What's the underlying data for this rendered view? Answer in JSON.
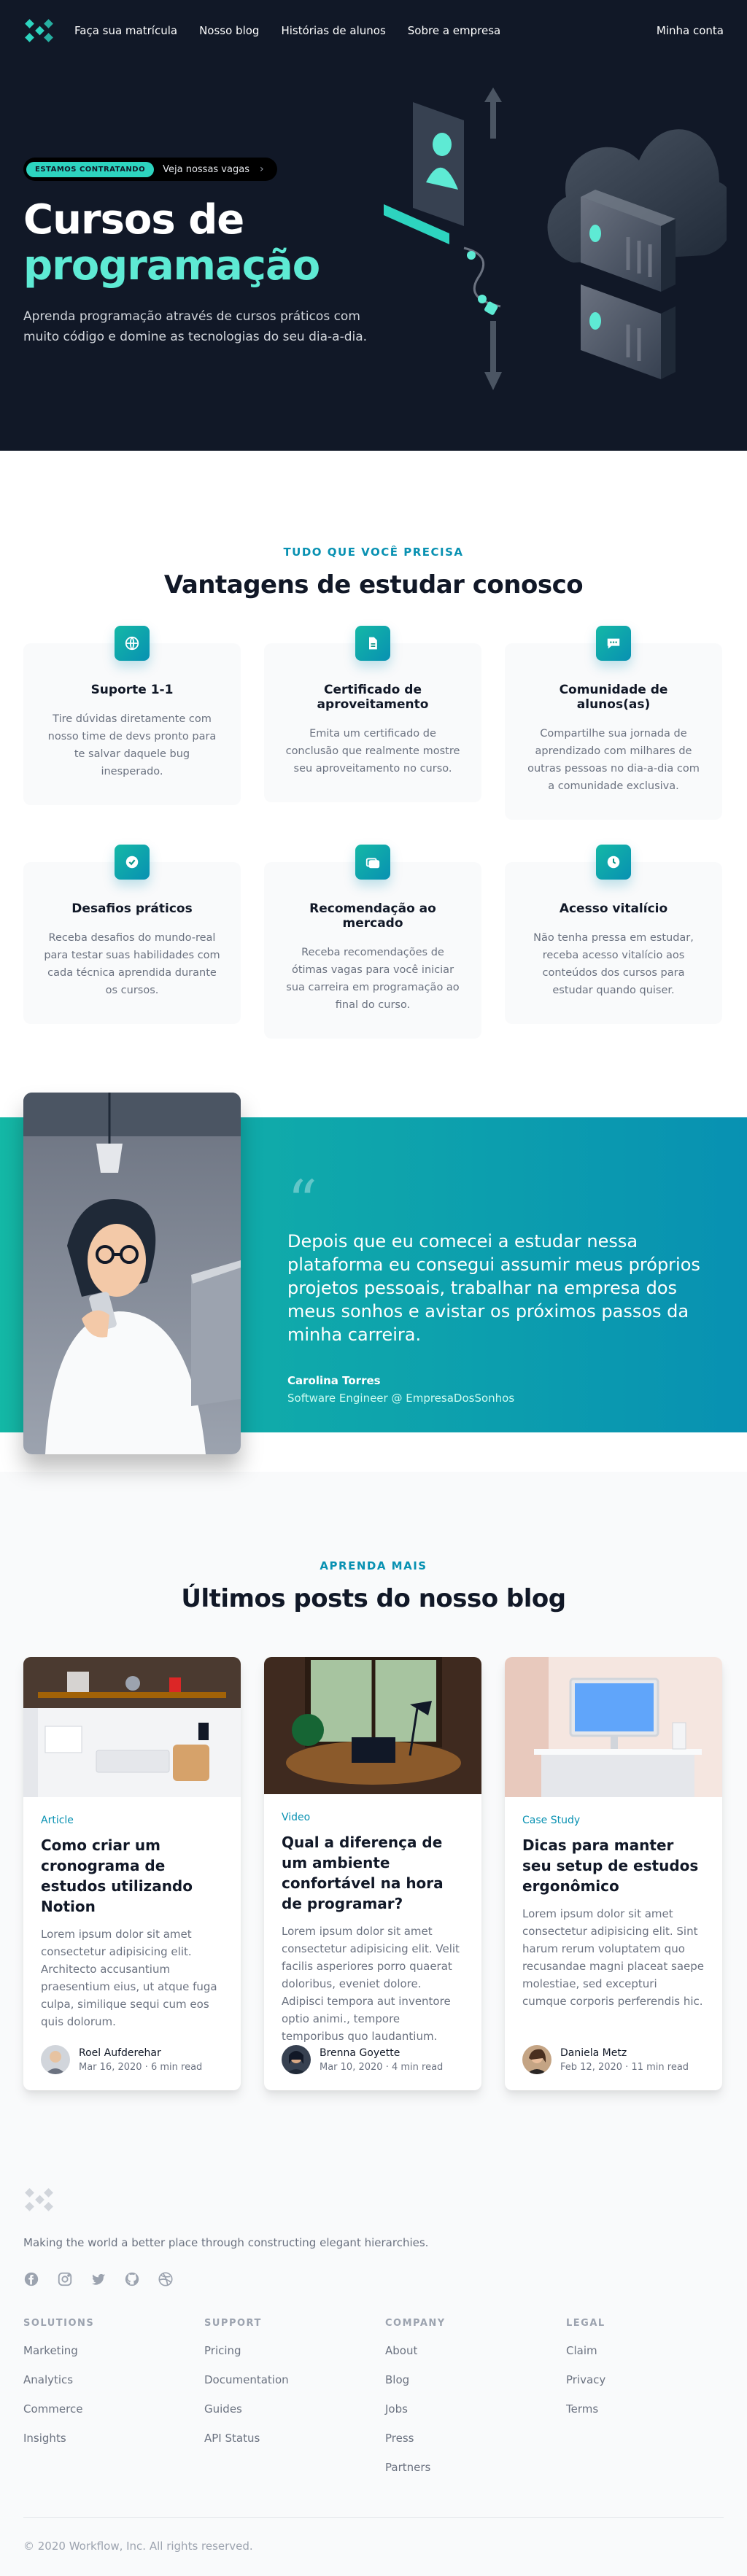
{
  "nav": {
    "links": [
      "Faça sua matrícula",
      "Nosso blog",
      "Histórias de alunos",
      "Sobre a empresa"
    ],
    "account": "Minha conta"
  },
  "hero": {
    "badge": "Estamos contratando",
    "badge_link": "Veja nossas vagas",
    "title_line1": "Cursos de",
    "title_line2": "programação",
    "subtitle": "Aprenda programação através de cursos práticos com muito código e domine as tecnologias do seu dia-a-dia."
  },
  "features": {
    "eyebrow": "Tudo que você precisa",
    "title": "Vantagens de estudar conosco",
    "items": [
      {
        "icon": "globe-icon",
        "title": "Suporte 1-1",
        "text": "Tire dúvidas diretamente com nosso time de devs pronto para te salvar daquele bug inesperado."
      },
      {
        "icon": "document-icon",
        "title": "Certificado de aproveitamento",
        "text": "Emita um certificado de conclusão que realmente mostre seu aproveitamento no curso."
      },
      {
        "icon": "chat-icon",
        "title": "Comunidade de alunos(as)",
        "text": "Compartilhe sua jornada de aprendizado com milhares de outras pessoas no dia-a-dia com a comunidade exclusiva."
      },
      {
        "icon": "check-badge-icon",
        "title": "Desafios práticos",
        "text": "Receba desafios do mundo-real para testar suas habilidades com cada técnica aprendida durante os cursos."
      },
      {
        "icon": "collection-icon",
        "title": "Recomendação ao mercado",
        "text": "Receba recomendações de ótimas vagas para você iniciar sua carreira em programação ao final do curso."
      },
      {
        "icon": "clock-icon",
        "title": "Acesso vitalício",
        "text": "Não tenha pressa em estudar, receba acesso vitalício aos conteúdos dos cursos para estudar quando quiser."
      }
    ]
  },
  "testimonial": {
    "quote": "Depois que eu comecei a estudar nessa plataforma eu consegui assumir meus próprios projetos pessoais, trabalhar na empresa dos meus sonhos e avistar os próximos passos da minha carreira.",
    "name": "Carolina Torres",
    "role": "Software Engineer @ EmpresaDosSonhos"
  },
  "blog": {
    "eyebrow": "Aprenda mais",
    "title": "Últimos posts do nosso blog",
    "posts": [
      {
        "category": "Article",
        "title": "Como criar um cronograma de estudos utilizando Notion",
        "excerpt": "Lorem ipsum dolor sit amet consectetur adipisicing elit. Architecto accusantium praesentium eius, ut atque fuga culpa, similique sequi cum eos quis dolorum.",
        "author": "Roel Aufderehar",
        "date": "Mar 16, 2020",
        "read": "6 min read"
      },
      {
        "category": "Video",
        "title": "Qual a diferença de um ambiente confortável na hora de programar?",
        "excerpt": "Lorem ipsum dolor sit amet consectetur adipisicing elit. Velit facilis asperiores porro quaerat doloribus, eveniet dolore. Adipisci tempora aut inventore optio animi., tempore temporibus quo laudantium.",
        "author": "Brenna Goyette",
        "date": "Mar 10, 2020",
        "read": "4 min read"
      },
      {
        "category": "Case Study",
        "title": "Dicas para manter seu setup de estudos ergonômico",
        "excerpt": "Lorem ipsum dolor sit amet consectetur adipisicing elit. Sint harum rerum voluptatem quo recusandae magni placeat saepe molestiae, sed excepturi cumque corporis perferendis hic.",
        "author": "Daniela Metz",
        "date": "Feb 12, 2020",
        "read": "11 min read"
      }
    ]
  },
  "footer": {
    "tagline": "Making the world a better place through constructing elegant hierarchies.",
    "social_icons": [
      "facebook-icon",
      "instagram-icon",
      "twitter-icon",
      "github-icon",
      "dribbble-icon"
    ],
    "columns": [
      {
        "heading": "Solutions",
        "links": [
          "Marketing",
          "Analytics",
          "Commerce",
          "Insights"
        ]
      },
      {
        "heading": "Support",
        "links": [
          "Pricing",
          "Documentation",
          "Guides",
          "API Status"
        ]
      },
      {
        "heading": "Company",
        "links": [
          "About",
          "Blog",
          "Jobs",
          "Press",
          "Partners"
        ]
      },
      {
        "heading": "Legal",
        "links": [
          "Claim",
          "Privacy",
          "Terms"
        ]
      }
    ],
    "copyright": "© 2020 Workflow, Inc. All rights reserved."
  },
  "colors": {
    "accent": "#2dd4bf",
    "accent_dark": "#0891b2",
    "hero_bg": "#111827"
  }
}
